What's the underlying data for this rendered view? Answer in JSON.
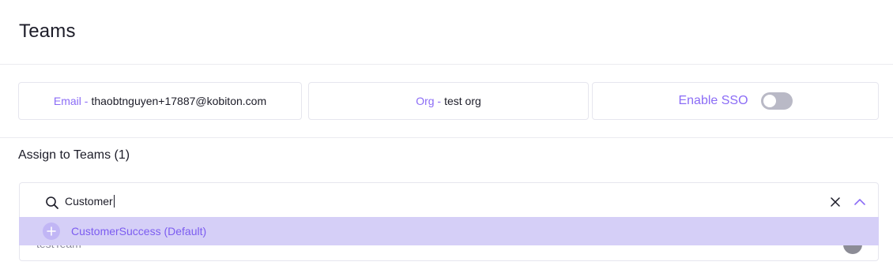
{
  "header": {
    "title": "Teams"
  },
  "info": {
    "email_label": "Email -",
    "email_value": "thaobtnguyen+17887@kobiton.com",
    "org_label": "Org -",
    "org_value": "test org",
    "sso_label": "Enable SSO",
    "sso_enabled": false
  },
  "assign": {
    "title": "Assign to Teams (1)",
    "search_value": "Customer",
    "selected_team_label": "testTeam",
    "option_label": "CustomerSuccess (Default)"
  },
  "icons": [
    "search-icon",
    "close-icon",
    "chevron-up-icon",
    "plus-icon"
  ],
  "colors": {
    "accent": "#8b6cf6",
    "option_highlight": "#d5cff7",
    "toggle_off": "#b9b9c6"
  }
}
